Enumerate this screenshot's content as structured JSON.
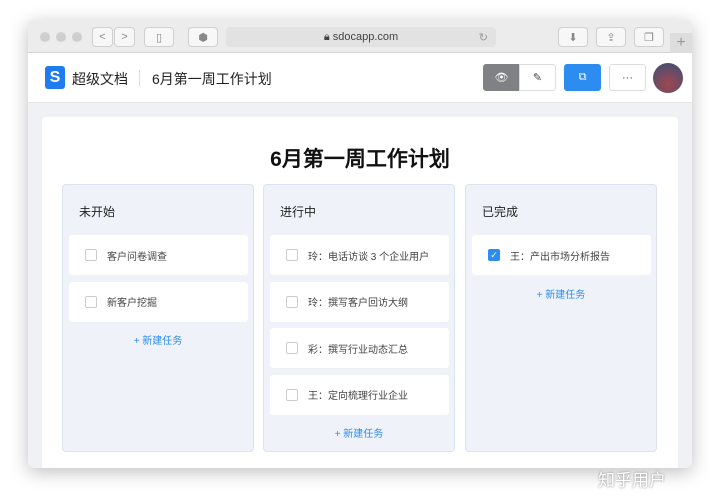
{
  "browser": {
    "url": "sdocapp.com"
  },
  "header": {
    "brand": "超级文档",
    "doc_title": "6月第一周工作计划",
    "more_label": "···"
  },
  "board": {
    "title": "6月第一周工作计划",
    "new_task_label": "+ 新建任务",
    "columns": [
      {
        "name": "未开始",
        "tasks": [
          {
            "text": "客户问卷调查",
            "done": false
          },
          {
            "text": "新客户挖掘",
            "done": false
          }
        ]
      },
      {
        "name": "进行中",
        "tasks": [
          {
            "text": "玲：电话访谈 3 个企业用户",
            "done": false
          },
          {
            "text": "玲：撰写客户回访大纲",
            "done": false
          },
          {
            "text": "彩：撰写行业动态汇总",
            "done": false
          },
          {
            "text": "王：定向梳理行业企业",
            "done": false
          }
        ]
      },
      {
        "name": "已完成",
        "tasks": [
          {
            "text": "王：产出市场分析报告",
            "done": true
          }
        ]
      }
    ]
  },
  "watermark": "知乎用户",
  "colors": {
    "accent": "#2d8cf0",
    "column_bg": "#eff3f9"
  }
}
